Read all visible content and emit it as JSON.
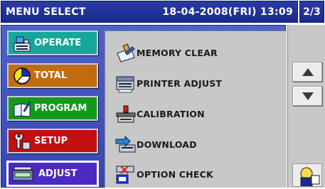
{
  "header": {
    "title": "MENU SELECT",
    "datetime": "18-04-2008(FRI) 13:09",
    "page_indicator": "2/3"
  },
  "categories": [
    {
      "label": "OPERATE",
      "icon": "cash-register-icon",
      "color": "#16a79a"
    },
    {
      "label": "TOTAL",
      "icon": "pie-chart-icon",
      "color": "#c26b10"
    },
    {
      "label": "PROGRAM",
      "icon": "book-pen-icon",
      "color": "#149a1a"
    },
    {
      "label": "SETUP",
      "icon": "wrench-icon",
      "color": "#c21010"
    },
    {
      "label": "ADJUST",
      "icon": "scale-icon",
      "color": "#4a2abf"
    }
  ],
  "menu_items": [
    {
      "label": "MEMORY CLEAR",
      "icon": "memory-clear-icon"
    },
    {
      "label": "PRINTER ADJUST",
      "icon": "printer-icon"
    },
    {
      "label": "CALIBRATION",
      "icon": "calibration-weight-icon"
    },
    {
      "label": "DOWNLOAD",
      "icon": "download-icon"
    },
    {
      "label": "OPTION CHECK",
      "icon": "option-check-icon"
    }
  ],
  "side": {
    "up_icon": "arrow-up-icon",
    "down_icon": "arrow-down-icon",
    "help_icon": "help-person-icon"
  },
  "colors": {
    "header_bg": "#1a2a8c",
    "main_bg": "#3546b2",
    "panel_bg": "#c8c8c8"
  }
}
